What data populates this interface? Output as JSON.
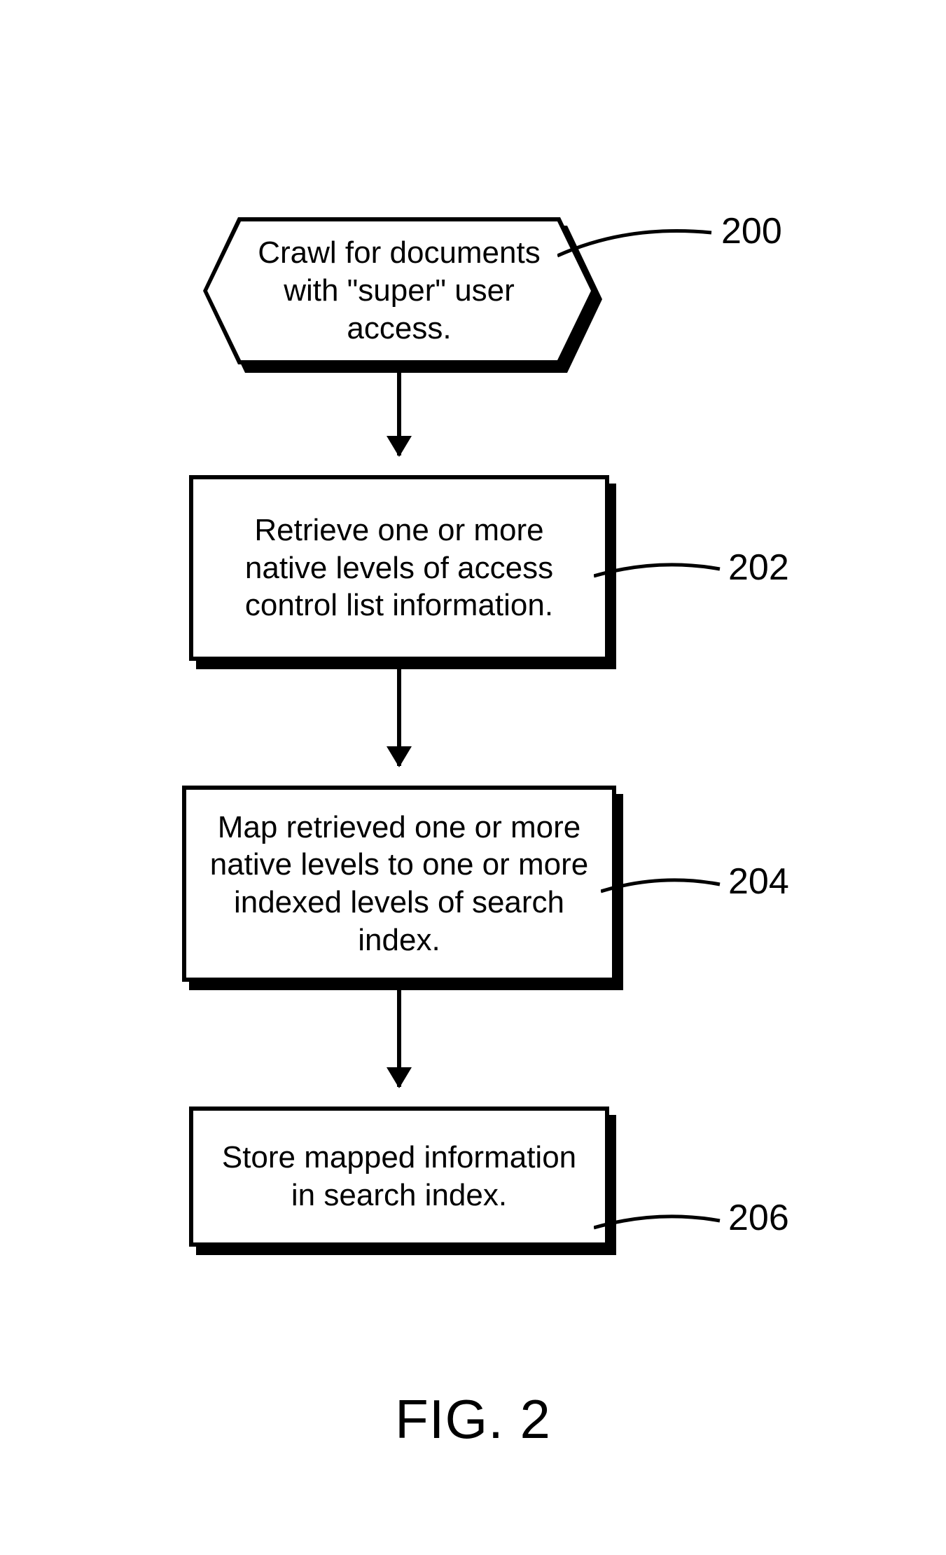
{
  "figure_caption": "FIG. 2",
  "nodes": {
    "n200": {
      "text": "Crawl for documents with \"super\" user access.",
      "ref": "200"
    },
    "n202": {
      "text": "Retrieve one or more native levels of access control list information.",
      "ref": "202"
    },
    "n204": {
      "text": "Map retrieved one or more native levels to one or more indexed levels of search index.",
      "ref": "204"
    },
    "n206": {
      "text": "Store mapped information in search index.",
      "ref": "206"
    }
  }
}
